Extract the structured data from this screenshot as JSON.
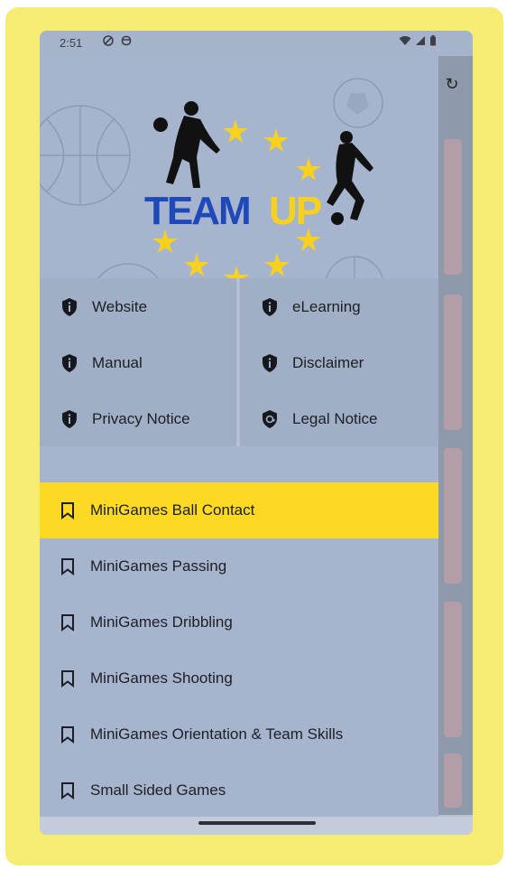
{
  "status_bar": {
    "time": "2:51"
  },
  "header": {
    "logo_team": "TEAM",
    "logo_up": "UP",
    "colors": {
      "team": "#1f49b8",
      "up": "#f7d11e",
      "star": "#f7d11e"
    }
  },
  "links": [
    {
      "label": "Website",
      "icon": "shield-info-icon"
    },
    {
      "label": "eLearning",
      "icon": "shield-info-icon"
    },
    {
      "label": "Manual",
      "icon": "shield-info-icon"
    },
    {
      "label": "Disclaimer",
      "icon": "shield-info-icon"
    },
    {
      "label": "Privacy Notice",
      "icon": "shield-info-icon"
    },
    {
      "label": "Legal Notice",
      "icon": "shield-at-icon"
    }
  ],
  "menu": [
    {
      "label": "MiniGames Ball Contact",
      "active": true
    },
    {
      "label": "MiniGames Passing",
      "active": false
    },
    {
      "label": "MiniGames Dribbling",
      "active": false
    },
    {
      "label": "MiniGames Shooting",
      "active": false
    },
    {
      "label": "MiniGames Orientation & Team Skills",
      "active": false
    },
    {
      "label": "Small Sided Games",
      "active": false
    }
  ],
  "colors": {
    "frame": "#f6ec73",
    "drawer": "#a6b5cd",
    "active_item": "#fdd924"
  }
}
